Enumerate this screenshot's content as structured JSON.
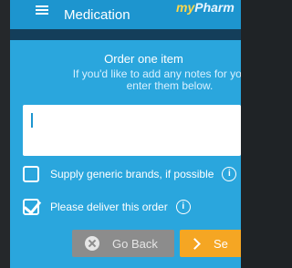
{
  "appbar": {
    "title": "Medication",
    "brand_prefix": "my",
    "brand_suffix": "Pharm"
  },
  "order": {
    "heading": "Order one item",
    "subtitle_line1": "If you'd like to add any notes for your ph",
    "subtitle_line2": "enter them below.",
    "notes_value": ""
  },
  "options": [
    {
      "label": "Supply generic brands, if possible",
      "checked": false
    },
    {
      "label": "Please deliver this order",
      "checked": true
    }
  ],
  "buttons": {
    "back_label": "Go Back",
    "send_label": "Se"
  },
  "icons": {
    "menu": "hamburger-menu-icon",
    "info": "info-icon",
    "back": "close-circle-icon",
    "send": "chevron-right-icon",
    "info_glyph": "i"
  },
  "colors": {
    "screen_bg": "#2aa6dd",
    "appbar_bg": "#1d95cf",
    "divider": "#143e5a",
    "back_button": "#8c8c8c",
    "send_button": "#f5a623",
    "brand": "#ffd84a"
  }
}
